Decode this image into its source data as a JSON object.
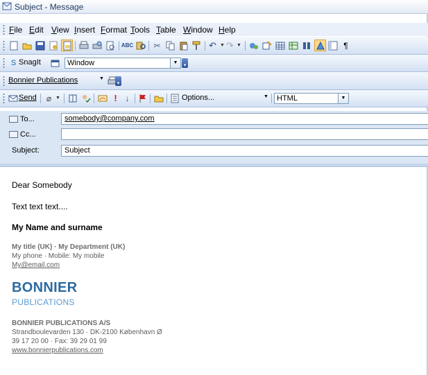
{
  "window": {
    "title": "Subject - Message"
  },
  "menu": [
    "File",
    "Edit",
    "View",
    "Insert",
    "Format",
    "Tools",
    "Table",
    "Window",
    "Help"
  ],
  "toolbar_std": {
    "icons": [
      "new-doc-icon",
      "open-folder-icon",
      "save-icon",
      "permission-icon",
      "email-icon",
      "print-icon",
      "print-preview-icon",
      "print-preview2-icon",
      "spelling-icon",
      "research-icon",
      "cut-icon",
      "copy-icon",
      "paste-icon",
      "format-painter-icon",
      "undo-icon",
      "redo-icon",
      "hyperlink-icon",
      "tables-borders-icon",
      "insert-table-icon",
      "insert-excel-icon",
      "columns-icon",
      "drawing-icon",
      "document-map-icon",
      "show-formatting-icon"
    ]
  },
  "snagit_bar": {
    "label": "SnagIt",
    "combo_value": "Window"
  },
  "bonnier_bar": {
    "label": "Bonnier Publications"
  },
  "mail_bar": {
    "send": "Send",
    "options": "Options...",
    "format_value": "HTML"
  },
  "header": {
    "to_label": "To...",
    "to_value": "somebody@company.com",
    "cc_label": "Cc...",
    "cc_value": "",
    "subject_label": "Subject:",
    "subject_value": "Subject"
  },
  "body": {
    "greeting": "Dear Somebody",
    "text": "Text text text....",
    "name": "My Name and surname",
    "title_line": "My title (UK) · My Department (UK)",
    "phone_line": "My phone · Mobile: My mobile",
    "email": "My@email.com",
    "brand": "BONNIER",
    "brand_sub": "PUBLICATIONS",
    "company": "BONNIER PUBLICATIONS A/S",
    "address": "Strandboulevarden 130 · DK-2100 København Ø",
    "phone_fax": "39 17 20 00 · Fax: 39 29 01 99",
    "website": "www.bonnierpublications.com"
  },
  "colors": {
    "accent": "#2c6aa0",
    "accent_light": "#5b9bd3",
    "toolbar": "#d4e1f3"
  }
}
